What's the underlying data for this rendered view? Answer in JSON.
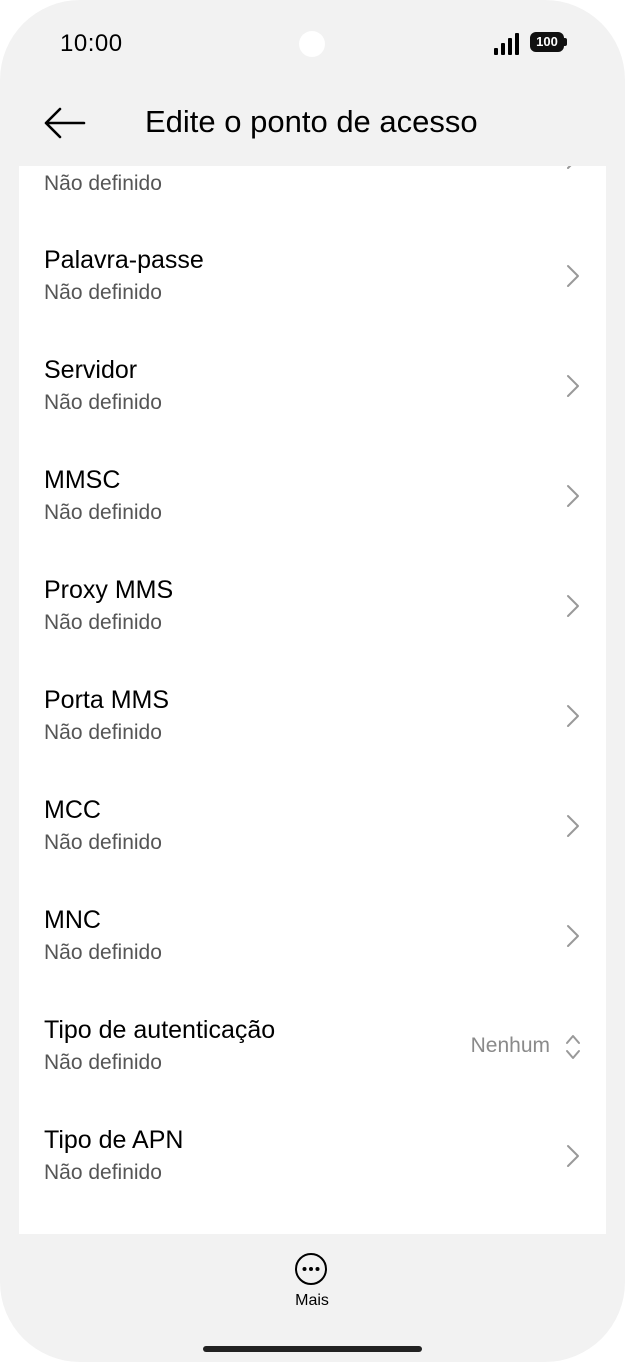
{
  "status_bar": {
    "time": "10:00",
    "battery_level": "100",
    "signal_icon": "signal-bars-icon",
    "battery_icon": "battery-icon"
  },
  "header": {
    "title": "Edite o ponto de acesso",
    "back_icon": "arrow-left-icon"
  },
  "settings": {
    "partial_top": {
      "subtitle": "Não definido"
    },
    "items": [
      {
        "title": "Palavra-passe",
        "subtitle": "Não definido"
      },
      {
        "title": "Servidor",
        "subtitle": "Não definido"
      },
      {
        "title": "MMSC",
        "subtitle": "Não definido"
      },
      {
        "title": "Proxy MMS",
        "subtitle": "Não definido"
      },
      {
        "title": "Porta MMS",
        "subtitle": "Não definido"
      },
      {
        "title": "MCC",
        "subtitle": "Não definido"
      },
      {
        "title": "MNC",
        "subtitle": "Não definido"
      },
      {
        "title": "Tipo de autenticação",
        "subtitle": "Não definido",
        "value": "Nenhum"
      },
      {
        "title": "Tipo de APN",
        "subtitle": "Não definido"
      }
    ]
  },
  "bottom": {
    "more_label": "Mais",
    "more_icon": "more-horizontal-circle-icon"
  },
  "colors": {
    "background": "#f2f2f2",
    "card": "#ffffff",
    "secondary_text": "#555555",
    "value_text": "#8a8a8a"
  }
}
